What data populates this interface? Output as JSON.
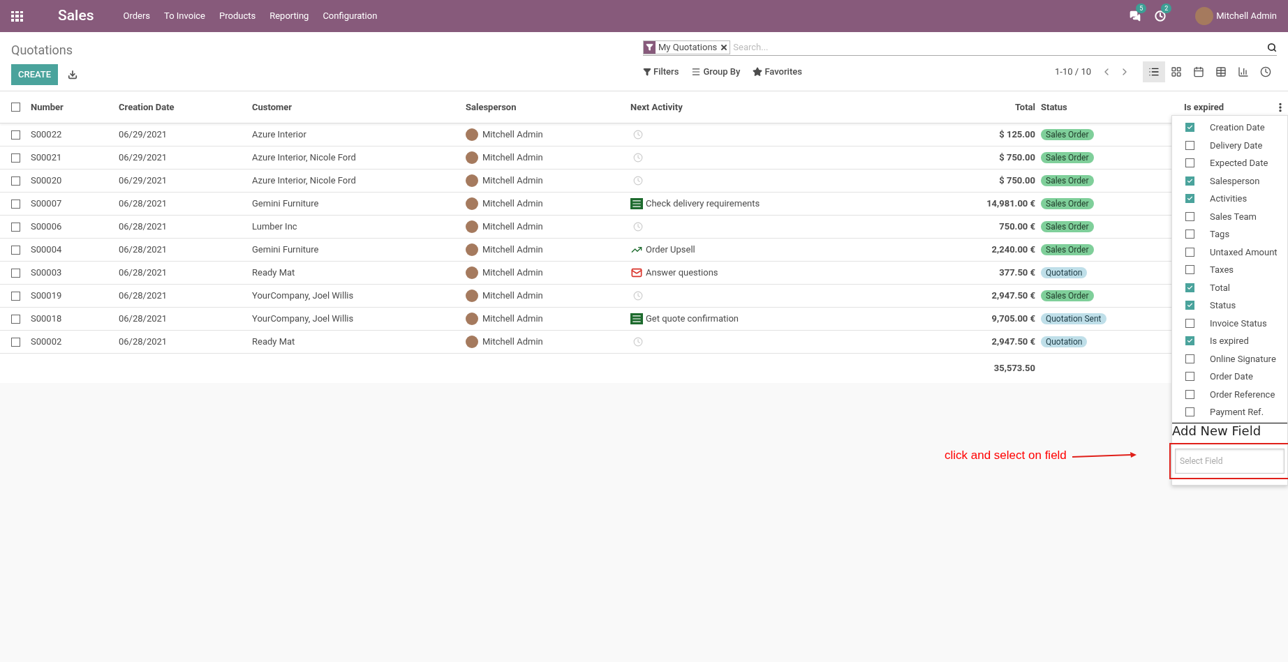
{
  "navbar": {
    "app": "Sales",
    "menu": [
      "Orders",
      "To Invoice",
      "Products",
      "Reporting",
      "Configuration"
    ],
    "messages_count": "5",
    "activities_count": "2",
    "user": "Mitchell Admin"
  },
  "control_panel": {
    "title": "Quotations",
    "create_button": "CREATE",
    "search": {
      "facet": "My Quotations",
      "placeholder": "Search..."
    },
    "search_options": [
      {
        "kind": "filter",
        "label": "Filters"
      },
      {
        "kind": "group",
        "label": "Group By"
      },
      {
        "kind": "star",
        "label": "Favorites"
      }
    ],
    "pager": "1-10 / 10",
    "views": [
      {
        "kind": "list",
        "selected": true
      },
      {
        "kind": "kanban",
        "selected": false
      },
      {
        "kind": "calendar",
        "selected": false
      },
      {
        "kind": "pivot",
        "selected": false
      },
      {
        "kind": "graph",
        "selected": false
      },
      {
        "kind": "activity",
        "selected": false
      }
    ]
  },
  "table": {
    "select_all": {
      "checked": false
    },
    "columns": [
      "Number",
      "Creation Date",
      "Customer",
      "Salesperson",
      "Next Activity",
      "Total",
      "Status",
      "Is expired"
    ],
    "rows": [
      {
        "checked": false,
        "number": "S00022",
        "date": "06/29/2021",
        "customer": "Azure Interior",
        "salesperson": "Mitchell Admin",
        "activity": {
          "kind": "none"
        },
        "total": "$ 125.00",
        "status": {
          "kind": "order",
          "label": "Sales Order"
        }
      },
      {
        "checked": false,
        "number": "S00021",
        "date": "06/29/2021",
        "customer": "Azure Interior, Nicole Ford",
        "salesperson": "Mitchell Admin",
        "activity": {
          "kind": "none"
        },
        "total": "$ 750.00",
        "status": {
          "kind": "order",
          "label": "Sales Order"
        }
      },
      {
        "checked": false,
        "number": "S00020",
        "date": "06/29/2021",
        "customer": "Azure Interior, Nicole Ford",
        "salesperson": "Mitchell Admin",
        "activity": {
          "kind": "none"
        },
        "total": "$ 750.00",
        "status": {
          "kind": "order",
          "label": "Sales Order"
        }
      },
      {
        "checked": false,
        "number": "S00007",
        "date": "06/28/2021",
        "customer": "Gemini Furniture",
        "salesperson": "Mitchell Admin",
        "activity": {
          "kind": "todo",
          "text": "Check delivery requirements"
        },
        "total": "14,981.00 €",
        "status": {
          "kind": "order",
          "label": "Sales Order"
        }
      },
      {
        "checked": false,
        "number": "S00006",
        "date": "06/28/2021",
        "customer": "Lumber Inc",
        "salesperson": "Mitchell Admin",
        "activity": {
          "kind": "none"
        },
        "total": "750.00 €",
        "status": {
          "kind": "order",
          "label": "Sales Order"
        }
      },
      {
        "checked": false,
        "number": "S00004",
        "date": "06/28/2021",
        "customer": "Gemini Furniture",
        "salesperson": "Mitchell Admin",
        "activity": {
          "kind": "upsell",
          "text": "Order Upsell"
        },
        "total": "2,240.00 €",
        "status": {
          "kind": "order",
          "label": "Sales Order"
        }
      },
      {
        "checked": false,
        "number": "S00003",
        "date": "06/28/2021",
        "customer": "Ready Mat",
        "salesperson": "Mitchell Admin",
        "activity": {
          "kind": "email",
          "text": "Answer questions"
        },
        "total": "377.50 €",
        "status": {
          "kind": "quote",
          "label": "Quotation"
        }
      },
      {
        "checked": false,
        "number": "S00019",
        "date": "06/28/2021",
        "customer": "YourCompany, Joel Willis",
        "salesperson": "Mitchell Admin",
        "activity": {
          "kind": "none"
        },
        "total": "2,947.50 €",
        "status": {
          "kind": "order",
          "label": "Sales Order"
        }
      },
      {
        "checked": false,
        "number": "S00018",
        "date": "06/28/2021",
        "customer": "YourCompany, Joel Willis",
        "salesperson": "Mitchell Admin",
        "activity": {
          "kind": "todo",
          "text": "Get quote confirmation"
        },
        "total": "9,705.00 €",
        "status": {
          "kind": "quote",
          "label": "Quotation Sent"
        }
      },
      {
        "checked": false,
        "number": "S00002",
        "date": "06/28/2021",
        "customer": "Ready Mat",
        "salesperson": "Mitchell Admin",
        "activity": {
          "kind": "none"
        },
        "total": "2,947.50 €",
        "status": {
          "kind": "quote",
          "label": "Quotation"
        }
      }
    ],
    "total": "35,573.50"
  },
  "column_menu": {
    "items": [
      {
        "label": "Creation Date",
        "checked": true
      },
      {
        "label": "Delivery Date",
        "checked": false
      },
      {
        "label": "Expected Date",
        "checked": false
      },
      {
        "label": "Salesperson",
        "checked": true
      },
      {
        "label": "Activities",
        "checked": true
      },
      {
        "label": "Sales Team",
        "checked": false
      },
      {
        "label": "Tags",
        "checked": false
      },
      {
        "label": "Untaxed Amount",
        "checked": false
      },
      {
        "label": "Taxes",
        "checked": false
      },
      {
        "label": "Total",
        "checked": true
      },
      {
        "label": "Status",
        "checked": true
      },
      {
        "label": "Invoice Status",
        "checked": false
      },
      {
        "label": "Is expired",
        "checked": true
      },
      {
        "label": "Online Signature",
        "checked": false
      },
      {
        "label": "Order Date",
        "checked": false
      },
      {
        "label": "Order Reference",
        "checked": false
      },
      {
        "label": "Payment Ref.",
        "checked": false
      }
    ],
    "add_title": "Add New Field",
    "select_placeholder": "Select Field"
  },
  "annotation": {
    "text": "click and select on field"
  }
}
